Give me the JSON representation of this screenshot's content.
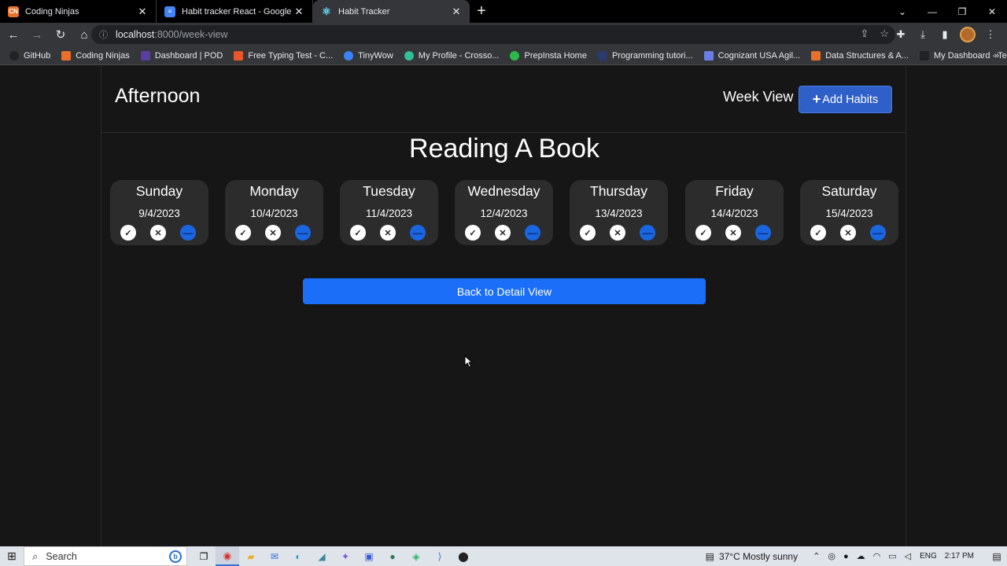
{
  "browser": {
    "tabs": [
      {
        "title": "Coding Ninjas",
        "icon": "coding-ninjas-icon",
        "color": "#e8702a"
      },
      {
        "title": "Habit tracker React - Google Docs",
        "icon": "google-docs-icon",
        "color": "#4285f4"
      },
      {
        "title": "Habit Tracker",
        "icon": "react-icon",
        "color": "#61dafb"
      }
    ],
    "active_tab": 2,
    "url_host": "localhost",
    "url_path": ":8000/week-view",
    "bookmarks": [
      {
        "label": "GitHub",
        "color": "#222222"
      },
      {
        "label": "Coding Ninjas",
        "color": "#e8702a"
      },
      {
        "label": "Dashboard | POD",
        "color": "#5a3fa0"
      },
      {
        "label": "Free Typing Test - C...",
        "color": "#e8562a"
      },
      {
        "label": "TinyWow",
        "color": "#3b82f6"
      },
      {
        "label": "My Profile - Crosso...",
        "color": "#2fbf9a"
      },
      {
        "label": "PrepInsta Home",
        "color": "#2fb84a"
      },
      {
        "label": "Programming tutori...",
        "color": "#2a3a6a"
      },
      {
        "label": "Cognizant USA Agil...",
        "color": "#6a7ee8"
      },
      {
        "label": "Data Structures & A...",
        "color": "#e8702a"
      },
      {
        "label": "My Dashboard - Te...",
        "color": "#222222"
      }
    ]
  },
  "app": {
    "greeting": "Afternoon",
    "view_label": "Week View",
    "add_button": "Add Habits",
    "habit_name": "Reading A Book",
    "back_button": "Back to Detail View",
    "days": [
      {
        "name": "Sunday",
        "date": "9/4/2023"
      },
      {
        "name": "Monday",
        "date": "10/4/2023"
      },
      {
        "name": "Tuesday",
        "date": "11/4/2023"
      },
      {
        "name": "Wednesday",
        "date": "12/4/2023"
      },
      {
        "name": "Thursday",
        "date": "13/4/2023"
      },
      {
        "name": "Friday",
        "date": "14/4/2023"
      },
      {
        "name": "Saturday",
        "date": "15/4/2023"
      }
    ],
    "colors": {
      "background": "#161616",
      "card": "#2c2c2c",
      "primary": "#1a6ef7",
      "add_button": "#2f5fc8"
    }
  },
  "taskbar": {
    "search_placeholder": "Search",
    "weather": "37°C  Mostly sunny",
    "language": "ENG",
    "time": "2:17 PM"
  }
}
